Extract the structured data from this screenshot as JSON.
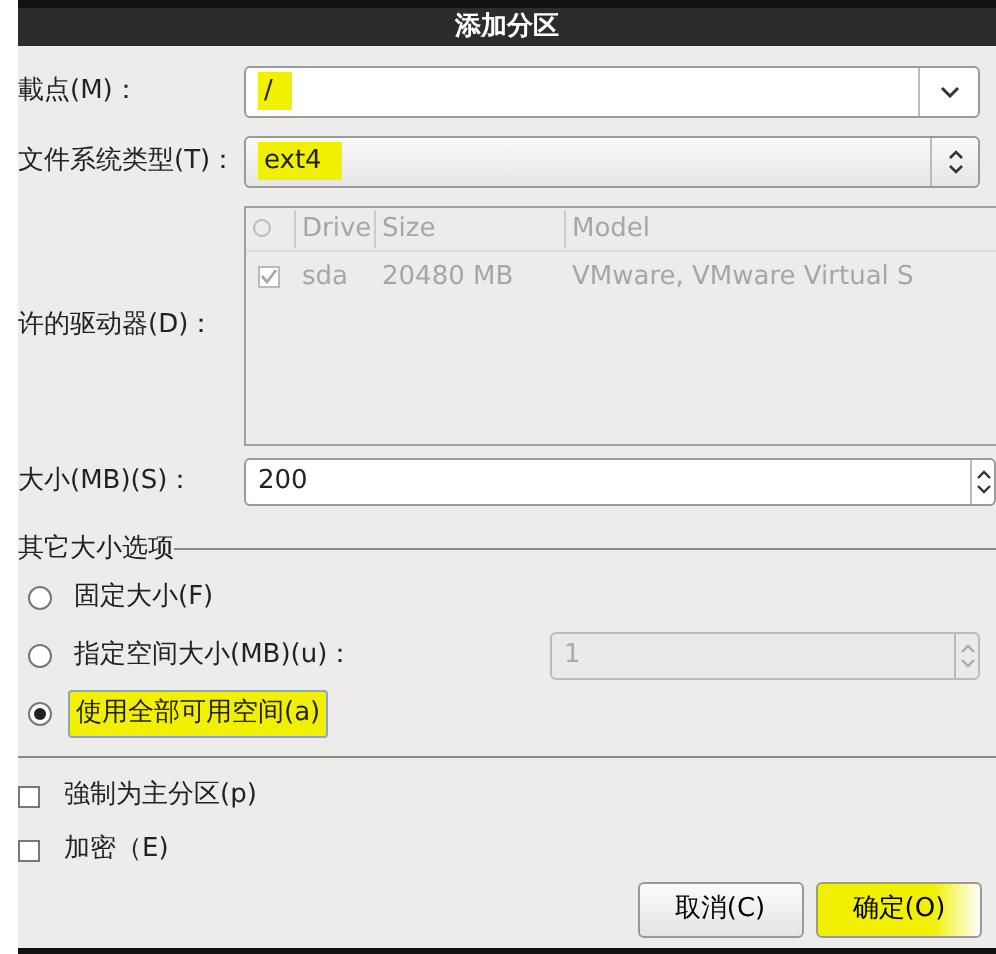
{
  "title": "添加分区",
  "mount_point": {
    "label": "載点(M)：",
    "value": "/",
    "highlighted": true
  },
  "fs_type": {
    "label": "文件系统类型(T)：",
    "value": "ext4",
    "highlighted": true
  },
  "drives": {
    "label": "许的驱动器(D)：",
    "disabled": true,
    "columns": [
      "Drive",
      "Size",
      "Model"
    ],
    "rows": [
      {
        "checked": true,
        "cells": [
          "sda",
          "20480 MB",
          "VMware, VMware Virtual S"
        ]
      }
    ]
  },
  "size": {
    "label": "大小(MB)(S)：",
    "value": "200"
  },
  "size_options": {
    "title": "其它大小选项",
    "options": [
      {
        "kind": "plain",
        "label": "固定大小(F)",
        "selected": false,
        "highlighted": false
      },
      {
        "kind": "spin",
        "label": "指定空间大小(MB)(u)：",
        "selected": false,
        "highlighted": false,
        "spin_value": "1",
        "disabled": true
      },
      {
        "kind": "plain",
        "label": "使用全部可用空间(a)",
        "selected": true,
        "highlighted": true
      }
    ]
  },
  "checkboxes": [
    {
      "label": "強制为主分区(p)",
      "checked": false
    },
    {
      "label": "加密（E)",
      "checked": false
    }
  ],
  "buttons": [
    {
      "label": "取消(C)",
      "highlighted": false
    },
    {
      "label": "确定(O)",
      "highlighted": true
    }
  ]
}
